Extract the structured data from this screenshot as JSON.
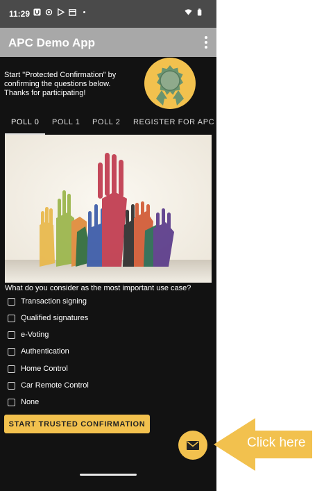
{
  "status": {
    "time": "11:29",
    "icons": [
      "u-box-icon",
      "settings-icon",
      "play-store-icon",
      "calendar-icon",
      "dot-icon",
      "wifi-icon",
      "battery-icon"
    ]
  },
  "appbar": {
    "title": "APC Demo App",
    "menu_icon": "more-vert-icon"
  },
  "intro": "Start \"Protected Confirmation\" by\nconfirming the questions below.\nThanks for participating!",
  "badge_icon": "award-ribbon-icon",
  "tabs": [
    {
      "label": "POLL 0",
      "active": true
    },
    {
      "label": "POLL 1",
      "active": false
    },
    {
      "label": "POLL 2",
      "active": false
    },
    {
      "label": "REGISTER FOR APC",
      "active": false
    }
  ],
  "question": "What do you consider as the most important use case?",
  "options": [
    "Transaction signing",
    "Qualified signatures",
    "e-Voting",
    "Authentication",
    "Home Control",
    "Car Remote Control",
    "None"
  ],
  "start_button": "START TRUSTED CONFIRMATION",
  "fab_icon": "mail-icon",
  "callout": {
    "text": "Click here"
  },
  "colors": {
    "accent": "#f2c14e",
    "background": "#121212",
    "appbar": "#a8a8a8",
    "statusbar": "#4a4a4a"
  }
}
